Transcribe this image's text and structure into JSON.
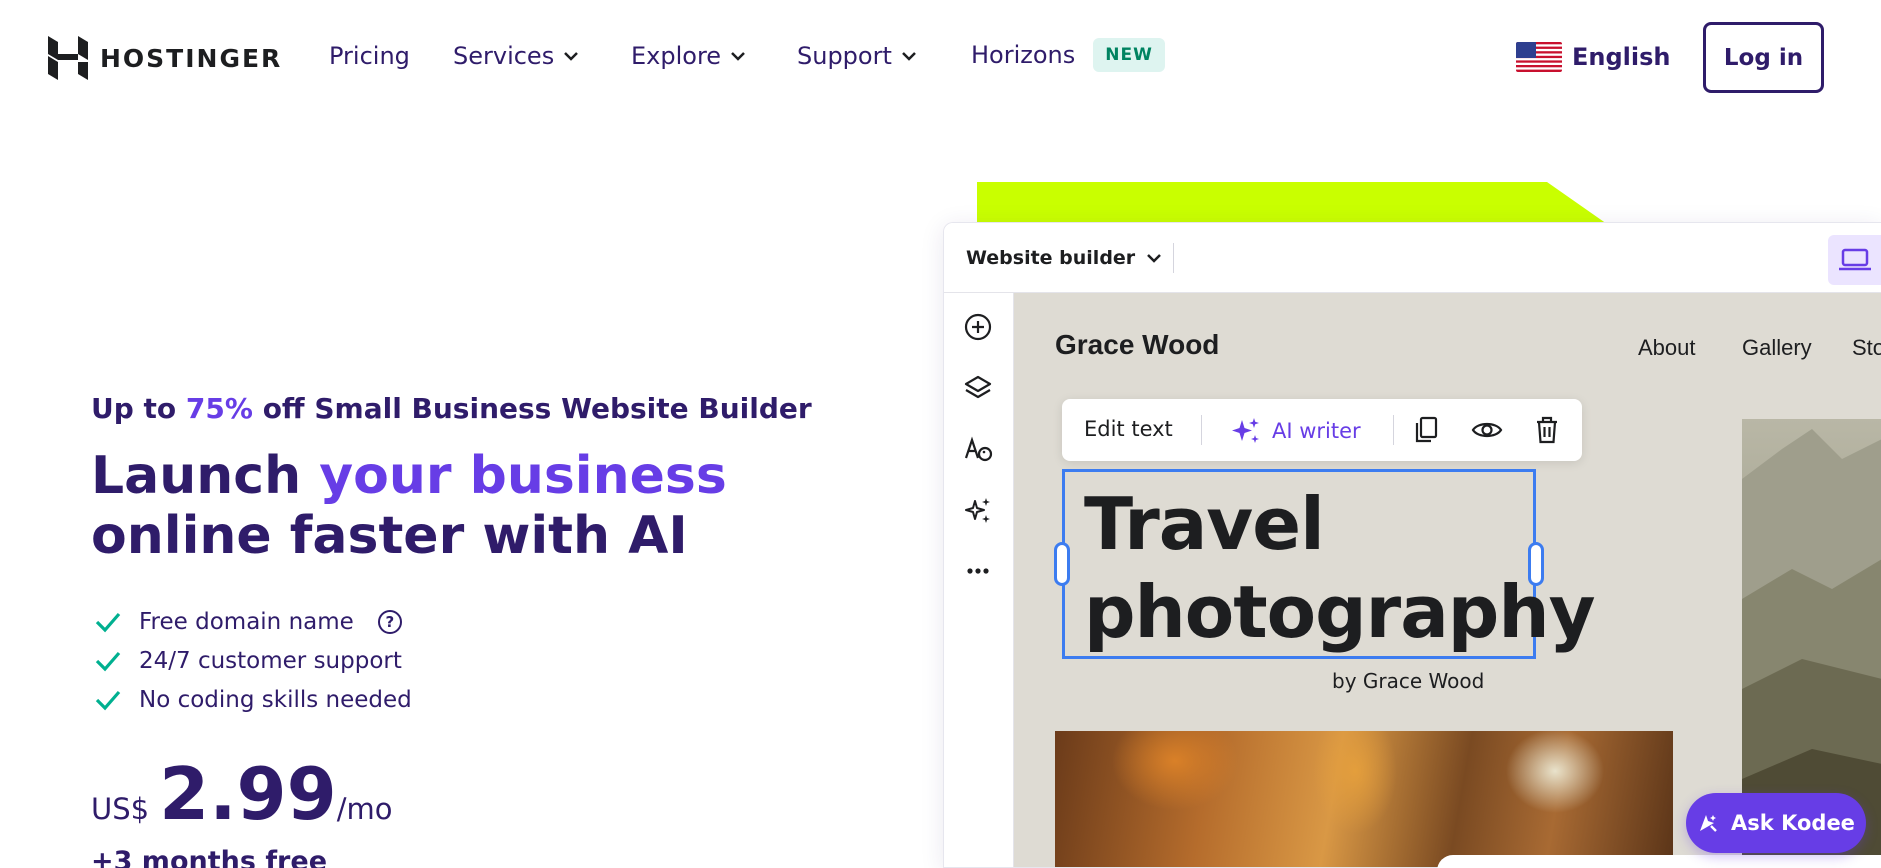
{
  "nav": {
    "brand": "HOSTINGER",
    "items": [
      {
        "label": "Pricing"
      },
      {
        "label": "Services"
      },
      {
        "label": "Explore"
      },
      {
        "label": "Support"
      },
      {
        "label": "Horizons"
      }
    ],
    "new_badge": "NEW",
    "language": "English",
    "login_label": "Log in"
  },
  "hero": {
    "promo_prefix": "Up to",
    "promo_percent": "75%",
    "promo_suffix": "off Small Business Website Builder",
    "headline_plain_1": "Launch",
    "headline_accent": "your business",
    "headline_line_2": "online faster with AI",
    "features": [
      "Free domain name",
      "24/7 customer support",
      "No coding skills needed"
    ],
    "price_currency": "US$",
    "price_amount": "2.99",
    "price_period": "/mo",
    "bonus": "+3 months free"
  },
  "builder": {
    "title": "Website builder",
    "site": {
      "name": "Grace Wood",
      "nav": [
        "About",
        "Gallery",
        "Store"
      ],
      "title_line_1": "Travel",
      "title_line_2": "photography",
      "byline": "by Grace Wood"
    },
    "toolbar": {
      "edit_text": "Edit text",
      "ai_writer": "AI writer"
    }
  },
  "chat": {
    "ask_label": "Ask Kodee"
  },
  "colors": {
    "brand_purple": "#673de6",
    "dark_navy": "#2f1c6a",
    "lime": "#c9ff00",
    "check_green": "#00b090",
    "selection_blue": "#3c7cf0"
  }
}
